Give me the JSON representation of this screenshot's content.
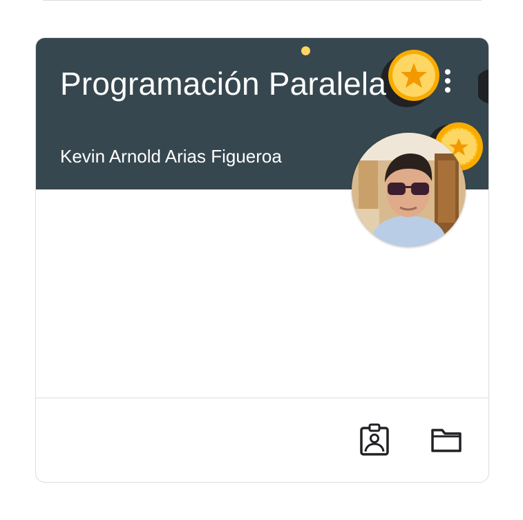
{
  "course": {
    "title": "Programación Paralela",
    "teacher": "Kevin Arnold Arias Figueroa"
  },
  "icons": {
    "more": "more-vert-icon",
    "portfolio": "assignment-ind-icon",
    "folder": "folder-icon"
  },
  "colors": {
    "header_bg": "#37474f",
    "accent_coin": "#fbbc04",
    "border": "#dadce0"
  }
}
